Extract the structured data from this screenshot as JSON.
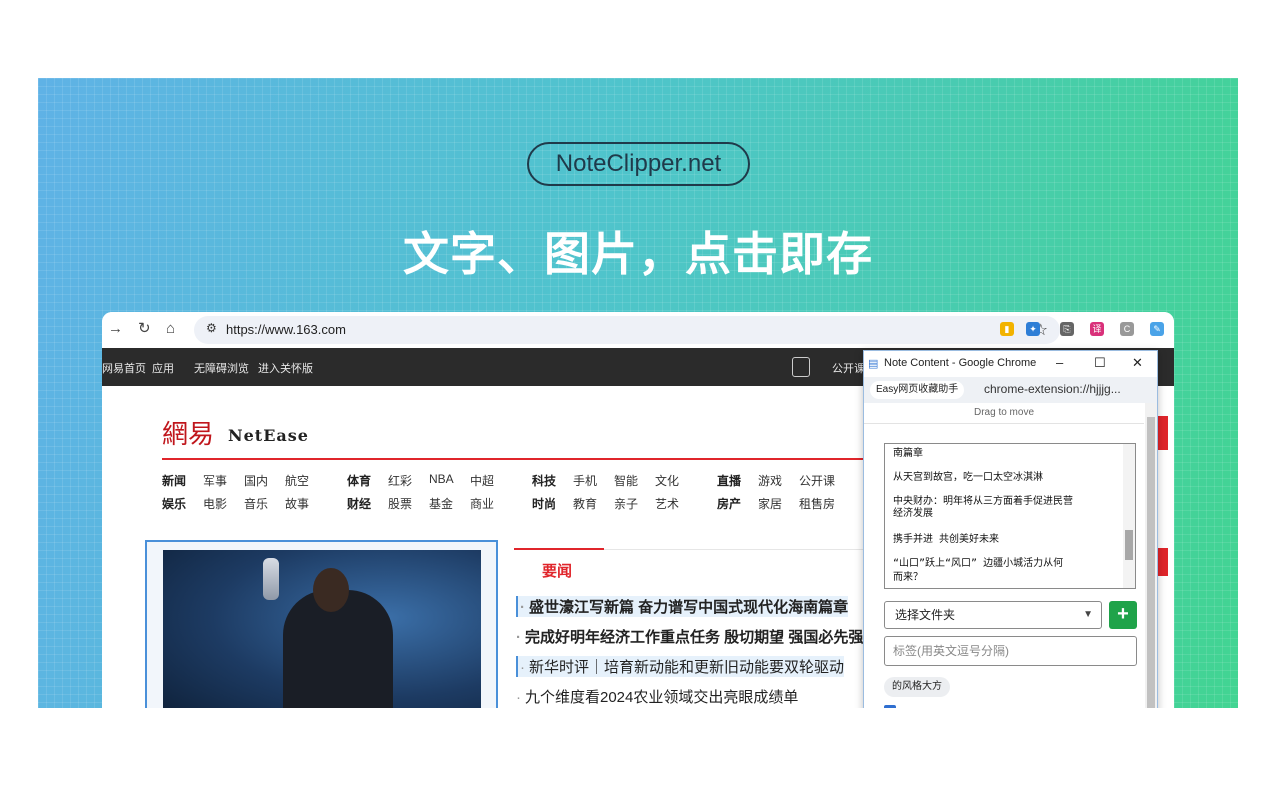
{
  "banner": {
    "site_pill": "NoteClipper.net",
    "headline": "文字、图片，点击即存"
  },
  "browser": {
    "url": "https://www.163.com",
    "nav_icons": [
      "forward-arrow",
      "reload",
      "home",
      "site-settings",
      "bookmark-star"
    ],
    "extension_icons": [
      "bookmark-ext",
      "pin-ext",
      "copy-ext",
      "translate-ext",
      "crx-ext",
      "note-ext"
    ]
  },
  "site_nav": {
    "left": [
      "网易首页",
      "应用",
      "无障碍浏览",
      "进入关怀版"
    ],
    "right": [
      "公开课"
    ]
  },
  "site": {
    "logo_cn": "網易",
    "logo_en": "NetEase",
    "nav_row1": [
      {
        "t": "新闻",
        "b": true
      },
      {
        "t": "军事"
      },
      {
        "t": "国内"
      },
      {
        "t": "航空"
      },
      {
        "t": "体育",
        "b": true
      },
      {
        "t": "红彩"
      },
      {
        "t": "NBA"
      },
      {
        "t": "中超"
      },
      {
        "t": "科技",
        "b": true
      },
      {
        "t": "手机"
      },
      {
        "t": "智能"
      },
      {
        "t": "文化"
      },
      {
        "t": "直播",
        "b": true
      },
      {
        "t": "游戏"
      },
      {
        "t": "公开课"
      }
    ],
    "nav_row2": [
      {
        "t": "娱乐",
        "b": true
      },
      {
        "t": "电影"
      },
      {
        "t": "音乐"
      },
      {
        "t": "故事"
      },
      {
        "t": "财经",
        "b": true
      },
      {
        "t": "股票"
      },
      {
        "t": "基金"
      },
      {
        "t": "商业"
      },
      {
        "t": "时尚",
        "b": true
      },
      {
        "t": "教育"
      },
      {
        "t": "亲子"
      },
      {
        "t": "艺术"
      },
      {
        "t": "房产",
        "b": true
      },
      {
        "t": "家居"
      },
      {
        "t": "租售房"
      }
    ],
    "news_tab": "要闻",
    "news": [
      {
        "text": "盛世濠江写新篇 奋力谱写中国式现代化海南篇章",
        "bold": true,
        "highlight": true
      },
      {
        "text": "完成好明年经济工作重点任务 殷切期望 强国必先强",
        "bold": true,
        "highlight": false
      },
      {
        "text": "新华时评｜培育新动能和更新旧动能要双轮驱动",
        "bold": false,
        "highlight": true
      },
      {
        "text": "九个维度看2024农业领域交出亮眼成绩单",
        "bold": false,
        "highlight": false
      }
    ]
  },
  "popup": {
    "title": "Note Content - Google Chrome",
    "chip": "Easy网页收藏助手",
    "address": "chrome-extension://hjjjg...",
    "drag_hint": "Drag to move",
    "content_lines": [
      "南篇章",
      "从天宫到故宫，吃一口太空冰淇淋",
      "中央财办：明年将从三方面着手促进民营",
      "经济发展",
      "携手并进 共创美好未来",
      "“山口”跃上“风口” 边疆小城活力从何",
      "而来？"
    ],
    "folder_select": "选择文件夹",
    "tags_placeholder": "标签(用英文逗号分隔)",
    "tag_chip": "的风格大方"
  }
}
